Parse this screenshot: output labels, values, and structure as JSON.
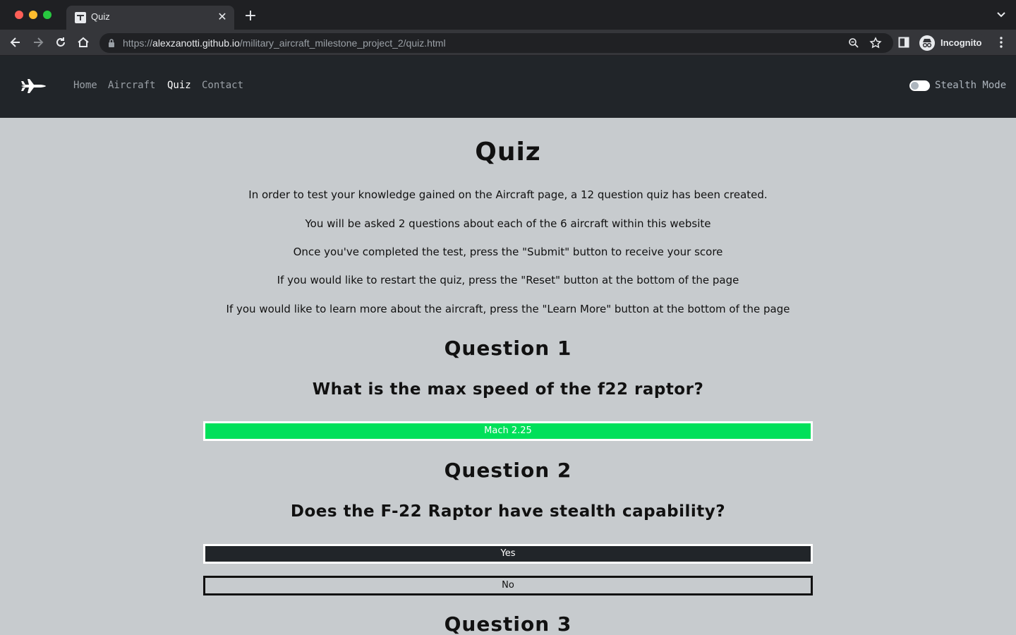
{
  "browser": {
    "tab_title": "Quiz",
    "url_scheme": "https://",
    "url_host": "alexzanotti.github.io",
    "url_path": "/military_aircraft_milestone_project_2/quiz.html",
    "profile_label": "Incognito"
  },
  "nav": {
    "links": [
      "Home",
      "Aircraft",
      "Quiz",
      "Contact"
    ],
    "active": "Quiz",
    "toggle_label": "Stealth Mode"
  },
  "page": {
    "title": "Quiz",
    "intro": [
      "In order to test your knowledge gained on the Aircraft page, a 12 question quiz has been created.",
      "You will be asked 2 questions about each of the 6 aircraft within this website",
      "Once you've completed the test, press the \"Submit\" button to receive your score",
      "If you would like to restart the quiz, press the \"Reset\" button at the bottom of the page",
      "If you would like to learn more about the aircraft, press the \"Learn More\" button at the bottom of the page"
    ]
  },
  "questions": [
    {
      "heading": "Question 1",
      "text": "What is the max speed of the f22 raptor?",
      "answers": [
        "Mach 2.25"
      ]
    },
    {
      "heading": "Question 2",
      "text": "Does the F-22 Raptor have stealth capability?",
      "answers": [
        "Yes",
        "No"
      ]
    },
    {
      "heading": "Question 3"
    }
  ],
  "colors": {
    "navbar": "#212529",
    "page_bg": "#c7cbce",
    "correct_answer": "#00e05a"
  }
}
